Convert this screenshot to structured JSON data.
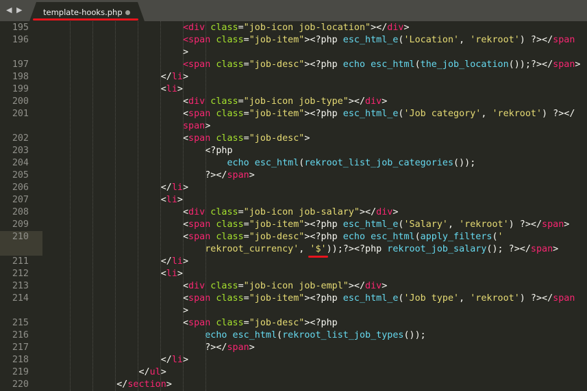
{
  "tab": {
    "title": "template-hooks.php",
    "back_arrow": "◀",
    "forward_arrow": "▶",
    "modified_indicator": "dot-icon"
  },
  "colors": {
    "background": "#272822",
    "tag": "#f92672",
    "attribute": "#a6e22e",
    "string": "#e6db74",
    "function": "#66d9ef",
    "text": "#f8f8f2",
    "line_number": "#90908a",
    "annotation": "#e8141d"
  },
  "lines": [
    {
      "n": "195",
      "indent": "                        ",
      "tokens": [
        [
          "t",
          "<"
        ],
        [
          "g",
          "div"
        ],
        [
          "w",
          " "
        ],
        [
          "a",
          "class"
        ],
        [
          "w",
          "="
        ],
        [
          "s",
          "\"job-icon job-location\""
        ],
        [
          "w",
          "></"
        ],
        [
          "g",
          "div"
        ],
        [
          "w",
          ">"
        ]
      ]
    },
    {
      "n": "196",
      "indent": "                        ",
      "tokens": [
        [
          "t",
          "<"
        ],
        [
          "g",
          "span"
        ],
        [
          "w",
          " "
        ],
        [
          "a",
          "class"
        ],
        [
          "w",
          "="
        ],
        [
          "s",
          "\"job-item\""
        ],
        [
          "w",
          ">"
        ],
        [
          "w",
          "<?php "
        ],
        [
          "f",
          "esc_html_e"
        ],
        [
          "w",
          "("
        ],
        [
          "s",
          "'Location'"
        ],
        [
          "w",
          ", "
        ],
        [
          "s",
          "'rekroot'"
        ],
        [
          "w",
          ") ?></"
        ],
        [
          "g",
          "span"
        ]
      ]
    },
    {
      "n": "",
      "indent": "                        ",
      "tokens": [
        [
          "w",
          ">"
        ]
      ]
    },
    {
      "n": "197",
      "indent": "                        ",
      "tokens": [
        [
          "t",
          "<"
        ],
        [
          "g",
          "span"
        ],
        [
          "w",
          " "
        ],
        [
          "a",
          "class"
        ],
        [
          "w",
          "="
        ],
        [
          "s",
          "\"job-desc\""
        ],
        [
          "w",
          ">"
        ],
        [
          "w",
          "<?php "
        ],
        [
          "f",
          "echo"
        ],
        [
          "w",
          " "
        ],
        [
          "f",
          "esc_html"
        ],
        [
          "w",
          "("
        ],
        [
          "f",
          "the_job_location"
        ],
        [
          "w",
          "());?></"
        ],
        [
          "g",
          "span"
        ],
        [
          "w",
          ">"
        ]
      ]
    },
    {
      "n": "198",
      "indent": "                    ",
      "tokens": [
        [
          "w",
          "</"
        ],
        [
          "g",
          "li"
        ],
        [
          "w",
          ">"
        ]
      ]
    },
    {
      "n": "199",
      "indent": "                    ",
      "tokens": [
        [
          "w",
          "<"
        ],
        [
          "g",
          "li"
        ],
        [
          "w",
          ">"
        ]
      ]
    },
    {
      "n": "200",
      "indent": "                        ",
      "tokens": [
        [
          "w",
          "<"
        ],
        [
          "g",
          "div"
        ],
        [
          "w",
          " "
        ],
        [
          "a",
          "class"
        ],
        [
          "w",
          "="
        ],
        [
          "s",
          "\"job-icon job-type\""
        ],
        [
          "w",
          "></"
        ],
        [
          "g",
          "div"
        ],
        [
          "w",
          ">"
        ]
      ]
    },
    {
      "n": "201",
      "indent": "                        ",
      "tokens": [
        [
          "w",
          "<"
        ],
        [
          "g",
          "span"
        ],
        [
          "w",
          " "
        ],
        [
          "a",
          "class"
        ],
        [
          "w",
          "="
        ],
        [
          "s",
          "\"job-item\""
        ],
        [
          "w",
          ">"
        ],
        [
          "w",
          "<?php "
        ],
        [
          "f",
          "esc_html_e"
        ],
        [
          "w",
          "("
        ],
        [
          "s",
          "'Job category'"
        ],
        [
          "w",
          ", "
        ],
        [
          "s",
          "'rekroot'"
        ],
        [
          "w",
          ") ?></"
        ]
      ]
    },
    {
      "n": "",
      "indent": "                        ",
      "tokens": [
        [
          "g",
          "span"
        ],
        [
          "w",
          ">"
        ]
      ]
    },
    {
      "n": "202",
      "indent": "                        ",
      "tokens": [
        [
          "w",
          "<"
        ],
        [
          "g",
          "span"
        ],
        [
          "w",
          " "
        ],
        [
          "a",
          "class"
        ],
        [
          "w",
          "="
        ],
        [
          "s",
          "\"job-desc\""
        ],
        [
          "w",
          ">"
        ]
      ]
    },
    {
      "n": "203",
      "indent": "                            ",
      "tokens": [
        [
          "w",
          "<?php"
        ]
      ]
    },
    {
      "n": "204",
      "indent": "                                ",
      "tokens": [
        [
          "f",
          "echo"
        ],
        [
          "w",
          " "
        ],
        [
          "f",
          "esc_html"
        ],
        [
          "w",
          "("
        ],
        [
          "f",
          "rekroot_list_job_categories"
        ],
        [
          "w",
          "());"
        ]
      ]
    },
    {
      "n": "205",
      "indent": "                            ",
      "tokens": [
        [
          "w",
          "?></"
        ],
        [
          "g",
          "span"
        ],
        [
          "w",
          ">"
        ]
      ]
    },
    {
      "n": "206",
      "indent": "                    ",
      "tokens": [
        [
          "w",
          "</"
        ],
        [
          "g",
          "li"
        ],
        [
          "w",
          ">"
        ]
      ]
    },
    {
      "n": "207",
      "indent": "                    ",
      "tokens": [
        [
          "w",
          "<"
        ],
        [
          "g",
          "li"
        ],
        [
          "w",
          ">"
        ]
      ]
    },
    {
      "n": "208",
      "indent": "                        ",
      "tokens": [
        [
          "w",
          "<"
        ],
        [
          "g",
          "div"
        ],
        [
          "w",
          " "
        ],
        [
          "a",
          "class"
        ],
        [
          "w",
          "="
        ],
        [
          "s",
          "\"job-icon job-salary\""
        ],
        [
          "w",
          "></"
        ],
        [
          "g",
          "div"
        ],
        [
          "w",
          ">"
        ]
      ]
    },
    {
      "n": "209",
      "indent": "                        ",
      "tokens": [
        [
          "w",
          "<"
        ],
        [
          "g",
          "span"
        ],
        [
          "w",
          " "
        ],
        [
          "a",
          "class"
        ],
        [
          "w",
          "="
        ],
        [
          "s",
          "\"job-item\""
        ],
        [
          "w",
          ">"
        ],
        [
          "w",
          "<?php "
        ],
        [
          "f",
          "esc_html_e"
        ],
        [
          "w",
          "("
        ],
        [
          "s",
          "'Salary'"
        ],
        [
          "w",
          ", "
        ],
        [
          "s",
          "'rekroot'"
        ],
        [
          "w",
          ") ?></"
        ],
        [
          "g",
          "span"
        ],
        [
          "w",
          ">"
        ]
      ]
    },
    {
      "n": "210",
      "indent": "                        ",
      "active": true,
      "tokens": [
        [
          "w",
          "<"
        ],
        [
          "g",
          "span"
        ],
        [
          "w",
          " "
        ],
        [
          "a",
          "class"
        ],
        [
          "w",
          "="
        ],
        [
          "s",
          "\"job-desc\""
        ],
        [
          "w",
          ">"
        ],
        [
          "w",
          "<?php "
        ],
        [
          "f",
          "echo"
        ],
        [
          "w",
          " "
        ],
        [
          "f",
          "esc_html"
        ],
        [
          "w",
          "("
        ],
        [
          "f",
          "apply_filters"
        ],
        [
          "w",
          "("
        ],
        [
          "s",
          "'"
        ]
      ]
    },
    {
      "n": "",
      "indent": "                            ",
      "active": true,
      "tokens": [
        [
          "s",
          "rekroot_currency'"
        ],
        [
          "w",
          ", "
        ],
        [
          "s",
          "'$'"
        ],
        [
          "w",
          "));?><?php "
        ],
        [
          "f",
          "rekroot_job_salary"
        ],
        [
          "w",
          "(); ?></"
        ],
        [
          "g",
          "span"
        ],
        [
          "w",
          ">"
        ]
      ]
    },
    {
      "n": "211",
      "indent": "                    ",
      "tokens": [
        [
          "w",
          "</"
        ],
        [
          "g",
          "li"
        ],
        [
          "w",
          ">"
        ]
      ]
    },
    {
      "n": "212",
      "indent": "                    ",
      "tokens": [
        [
          "w",
          "<"
        ],
        [
          "g",
          "li"
        ],
        [
          "w",
          ">"
        ]
      ]
    },
    {
      "n": "213",
      "indent": "                        ",
      "tokens": [
        [
          "w",
          "<"
        ],
        [
          "g",
          "div"
        ],
        [
          "w",
          " "
        ],
        [
          "a",
          "class"
        ],
        [
          "w",
          "="
        ],
        [
          "s",
          "\"job-icon job-empl\""
        ],
        [
          "w",
          "></"
        ],
        [
          "g",
          "div"
        ],
        [
          "w",
          ">"
        ]
      ]
    },
    {
      "n": "214",
      "indent": "                        ",
      "tokens": [
        [
          "w",
          "<"
        ],
        [
          "g",
          "span"
        ],
        [
          "w",
          " "
        ],
        [
          "a",
          "class"
        ],
        [
          "w",
          "="
        ],
        [
          "s",
          "\"job-item\""
        ],
        [
          "w",
          ">"
        ],
        [
          "w",
          "<?php "
        ],
        [
          "f",
          "esc_html_e"
        ],
        [
          "w",
          "("
        ],
        [
          "s",
          "'Job type'"
        ],
        [
          "w",
          ", "
        ],
        [
          "s",
          "'rekroot'"
        ],
        [
          "w",
          ") ?></"
        ],
        [
          "g",
          "span"
        ]
      ]
    },
    {
      "n": "",
      "indent": "                        ",
      "tokens": [
        [
          "w",
          ">"
        ]
      ]
    },
    {
      "n": "215",
      "indent": "                        ",
      "tokens": [
        [
          "w",
          "<"
        ],
        [
          "g",
          "span"
        ],
        [
          "w",
          " "
        ],
        [
          "a",
          "class"
        ],
        [
          "w",
          "="
        ],
        [
          "s",
          "\"job-desc\""
        ],
        [
          "w",
          ">"
        ],
        [
          "w",
          "<?php"
        ]
      ]
    },
    {
      "n": "216",
      "indent": "                            ",
      "tokens": [
        [
          "f",
          "echo"
        ],
        [
          "w",
          " "
        ],
        [
          "f",
          "esc_html"
        ],
        [
          "w",
          "("
        ],
        [
          "f",
          "rekroot_list_job_types"
        ],
        [
          "w",
          "());"
        ]
      ]
    },
    {
      "n": "217",
      "indent": "                            ",
      "tokens": [
        [
          "w",
          "?></"
        ],
        [
          "g",
          "span"
        ],
        [
          "w",
          ">"
        ]
      ]
    },
    {
      "n": "218",
      "indent": "                    ",
      "tokens": [
        [
          "w",
          "</"
        ],
        [
          "g",
          "li"
        ],
        [
          "w",
          ">"
        ]
      ]
    },
    {
      "n": "219",
      "indent": "                ",
      "tokens": [
        [
          "w",
          "</"
        ],
        [
          "g",
          "ul"
        ],
        [
          "w",
          ">"
        ]
      ]
    },
    {
      "n": "220",
      "indent": "            ",
      "tokens": [
        [
          "w",
          "</"
        ],
        [
          "g",
          "section"
        ],
        [
          "w",
          ">"
        ]
      ]
    }
  ]
}
